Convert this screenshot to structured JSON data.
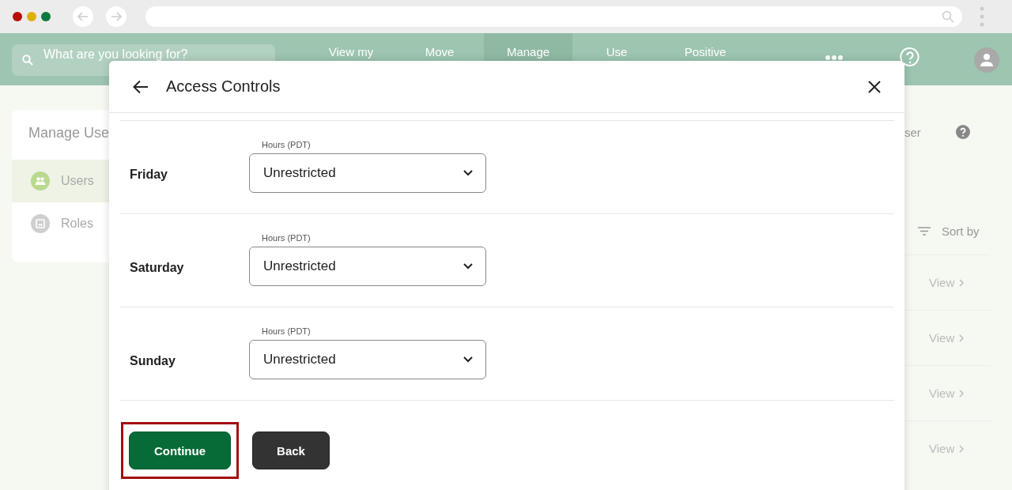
{
  "header": {
    "search": {
      "placeholder": "What are you looking for?"
    },
    "nav": [
      {
        "label": "View my",
        "selected": false
      },
      {
        "label": "Move",
        "selected": false
      },
      {
        "label": "Manage",
        "selected": true
      },
      {
        "label": "Use",
        "selected": false
      },
      {
        "label": "Positive",
        "selected": false
      }
    ]
  },
  "sidebar": {
    "title": "Manage Use",
    "items": [
      {
        "label": "Users",
        "kind": "users",
        "selected": true
      },
      {
        "label": "Roles",
        "kind": "roles",
        "selected": false
      }
    ]
  },
  "page": {
    "header_text": "ser",
    "sort": "Sort by",
    "rows": [
      {
        "action": "View"
      },
      {
        "action": "View"
      },
      {
        "action": "View"
      },
      {
        "action": "View"
      }
    ]
  },
  "modal": {
    "title": "Access Controls",
    "days": [
      {
        "day": "Friday",
        "field_label": "Hours (PDT)",
        "value": "Unrestricted"
      },
      {
        "day": "Saturday",
        "field_label": "Hours (PDT)",
        "value": "Unrestricted"
      },
      {
        "day": "Sunday",
        "field_label": "Hours (PDT)",
        "value": "Unrestricted"
      }
    ],
    "buttons": [
      {
        "label": "Continue",
        "kind": "primary",
        "highlighted": true
      },
      {
        "label": "Back",
        "kind": "secondary",
        "highlighted": false
      }
    ]
  }
}
